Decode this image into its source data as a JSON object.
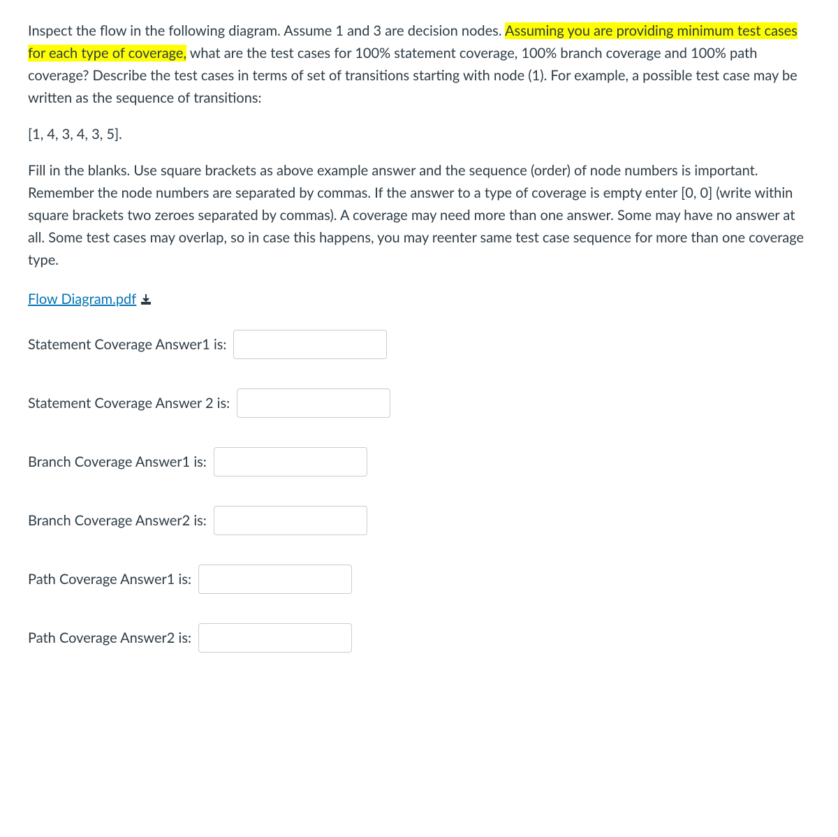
{
  "question": {
    "intro_before_highlight": "Inspect the flow in the following diagram. Assume 1 and 3 are decision nodes. ",
    "highlight_text": "Assuming you are providing minimum test cases for each type of coverage,",
    "intro_after_highlight": "  what are the test cases for 100% statement coverage, 100% branch coverage and 100% path coverage? Describe the test cases in terms of set of transitions starting with node (1). For example, a possible test case may be written as the sequence of transitions:",
    "example_sequence": "[1, 4, 3, 4, 3, 5].",
    "instructions": "Fill  in the blanks. Use square brackets as above example answer and the sequence (order) of node numbers is important.   Remember the node numbers are separated by commas. If the answer to a type of coverage is empty enter [0, 0]  (write within square brackets two zeroes separated by commas).  A coverage may need more than one answer.  Some may have no answer at all. Some test cases may overlap, so in case this  happens, you may reenter same test case sequence for more than one coverage type."
  },
  "attachment": {
    "label": "Flow Diagram.pdf"
  },
  "answers": [
    {
      "label": "Statement Coverage  Answer1 is:",
      "value": ""
    },
    {
      "label": "Statement Coverage Answer 2 is:",
      "value": ""
    },
    {
      "label": "Branch Coverage Answer1 is:",
      "value": ""
    },
    {
      "label": "Branch Coverage Answer2 is:",
      "value": ""
    },
    {
      "label": "Path Coverage Answer1 is:",
      "value": ""
    },
    {
      "label": "Path Coverage Answer2 is:",
      "value": ""
    }
  ]
}
